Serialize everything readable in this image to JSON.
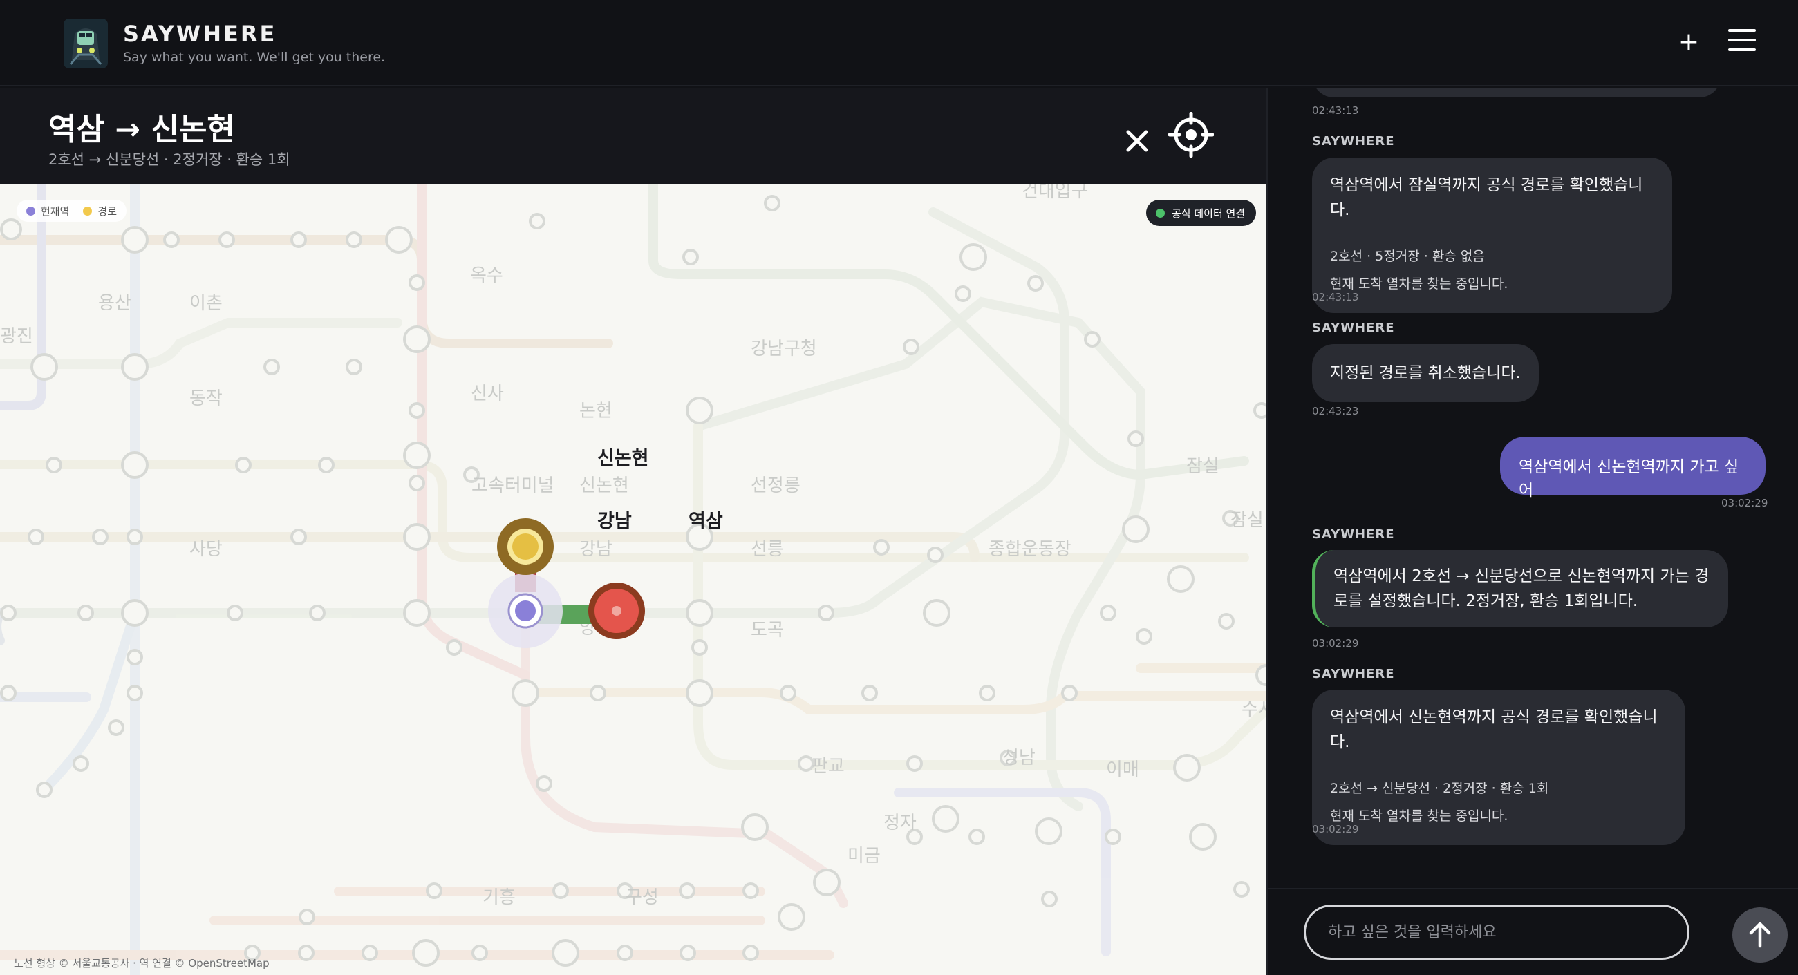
{
  "app": {
    "brand": "SAYWHERE",
    "tagline": "Say what you want. We'll get you there.",
    "plus_label": "+"
  },
  "route": {
    "title": "역삼 → 신논현",
    "summary": "2호선 → 신분당선 · 2정거장 · 환승 1회"
  },
  "map": {
    "legend": [
      {
        "label": "현재역",
        "color": "#8a80d8"
      },
      {
        "label": "경로",
        "color": "#f2c94c"
      }
    ],
    "official_badge": "공식 데이터 연결",
    "credit": "노선 형상 © 서울교통공사 · 역 연결 © OpenStreetMap",
    "route_labels": {
      "start": "역삼",
      "transfer": "강남",
      "end": "신논현"
    },
    "faded_labels": [
      "건대입구",
      "옥수",
      "용산",
      "이촌",
      "광진",
      "동작",
      "신사",
      "논현",
      "강남구청",
      "선정릉",
      "고속터미널",
      "신논현",
      "사당",
      "강남",
      "선릉",
      "종합운동장",
      "잠실",
      "잠실",
      "양재",
      "도곡",
      "수서",
      "판교",
      "성남",
      "이매",
      "정자",
      "미금",
      "기흥",
      "구성"
    ],
    "colors": {
      "line2": "#5aa35a",
      "sinbundang": "#b13b4a",
      "current": "#8a80d8",
      "start": "#e4554c",
      "transfer": "#f2c94c"
    }
  },
  "chat": {
    "messages": [
      {
        "type": "time",
        "time": "02:43:13"
      },
      {
        "type": "bot",
        "sender": "SAYWHERE",
        "text": "역삼역에서 잠실역까지 공식 경로를 확인했습니다.",
        "meta": [
          "2호선 · 5정거장 · 환승 없음",
          "현재 도착 열차를 찾는 중입니다."
        ],
        "time": "02:43:13"
      },
      {
        "type": "bot",
        "sender": "SAYWHERE",
        "text": "지정된 경로를 취소했습니다.",
        "time": "02:43:23"
      },
      {
        "type": "user",
        "text": "역삼역에서 신논현역까지 가고 싶어",
        "time": "03:02:29"
      },
      {
        "type": "bot",
        "sender": "SAYWHERE",
        "text_lines": [
          "역삼역에서 2호선 → 신분당선으로 신논현역까지 가는 경",
          "로를 설정했습니다. 2정거장, 환승 1회입니다."
        ],
        "time": "03:02:29"
      },
      {
        "type": "bot",
        "sender": "SAYWHERE",
        "text": "역삼역에서 신논현역까지 공식 경로를 확인했습니다.",
        "meta": [
          "2호선 → 신분당선 · 2정거장 · 환승 1회",
          "현재 도착 열차를 찾는 중입니다."
        ],
        "time": "03:02:29"
      }
    ]
  },
  "composer": {
    "placeholder": "하고 싶은 것을 입력하세요"
  }
}
